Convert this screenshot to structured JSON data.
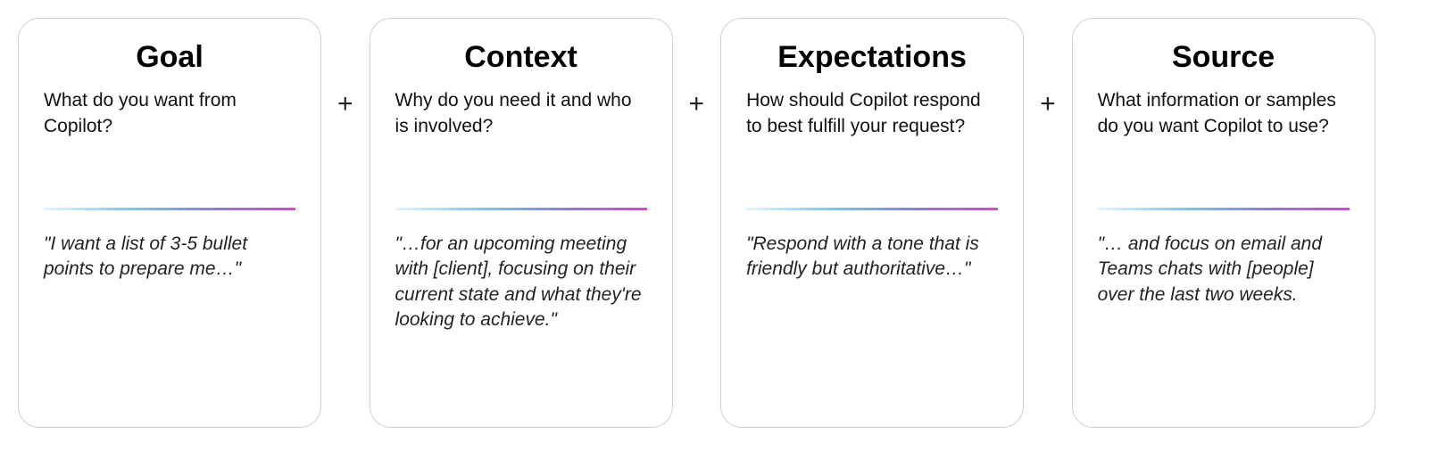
{
  "cards": [
    {
      "title": "Goal",
      "question": "What do you want from Copilot?",
      "example": "\"I want a list of 3-5 bullet points to prepare me…\""
    },
    {
      "title": "Context",
      "question": "Why do you need it and who is involved?",
      "example": "\"…for an upcoming meeting with [client], focusing on their current state and what they're looking to achieve.\""
    },
    {
      "title": "Expectations",
      "question": "How should Copilot respond to best fulfill your request?",
      "example": "\"Respond with a tone that is friendly but authoritative…\""
    },
    {
      "title": "Source",
      "question": "What information or samples do you want Copilot to use?",
      "example": "\"… and focus on email and Teams chats with [people] over the last two weeks."
    }
  ],
  "separator": "+"
}
